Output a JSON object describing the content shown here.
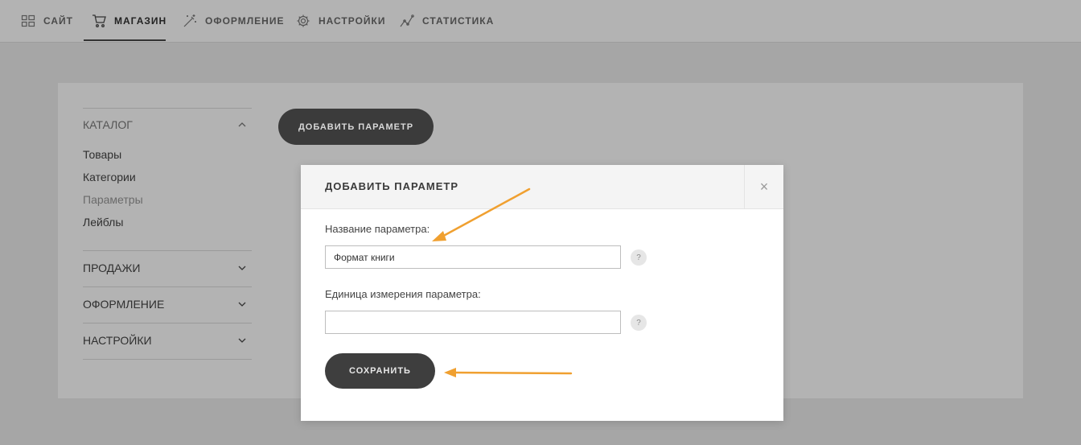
{
  "nav": {
    "items": [
      {
        "label": "САЙТ",
        "icon": "grid-icon"
      },
      {
        "label": "МАГАЗИН",
        "icon": "cart-icon",
        "active": true
      },
      {
        "label": "ОФОРМЛЕНИЕ",
        "icon": "magic-wand-icon"
      },
      {
        "label": "НАСТРОЙКИ",
        "icon": "gear-icon"
      },
      {
        "label": "СТАТИСТИКА",
        "icon": "chart-line-icon"
      }
    ]
  },
  "sidebar": {
    "catalog": {
      "title": "КАТАЛОГ",
      "items": [
        "Товары",
        "Категории",
        "Параметры",
        "Лейблы"
      ]
    },
    "sections": [
      "ПРОДАЖИ",
      "ОФОРМЛЕНИЕ",
      "НАСТРОЙКИ"
    ]
  },
  "main": {
    "add_button_label": "ДОБАВИТЬ ПАРАМЕТР"
  },
  "modal": {
    "title": "ДОБАВИТЬ ПАРАМЕТР",
    "close_glyph": "×",
    "name_label": "Название параметра:",
    "name_value": "Формат книги",
    "unit_label": "Единица измерения параметра:",
    "unit_value": "",
    "help_glyph": "?",
    "save_label": "СОХРАНИТЬ"
  },
  "colors": {
    "annotation_arrow": "#f0a030",
    "button_dark": "#3b3b3b"
  }
}
